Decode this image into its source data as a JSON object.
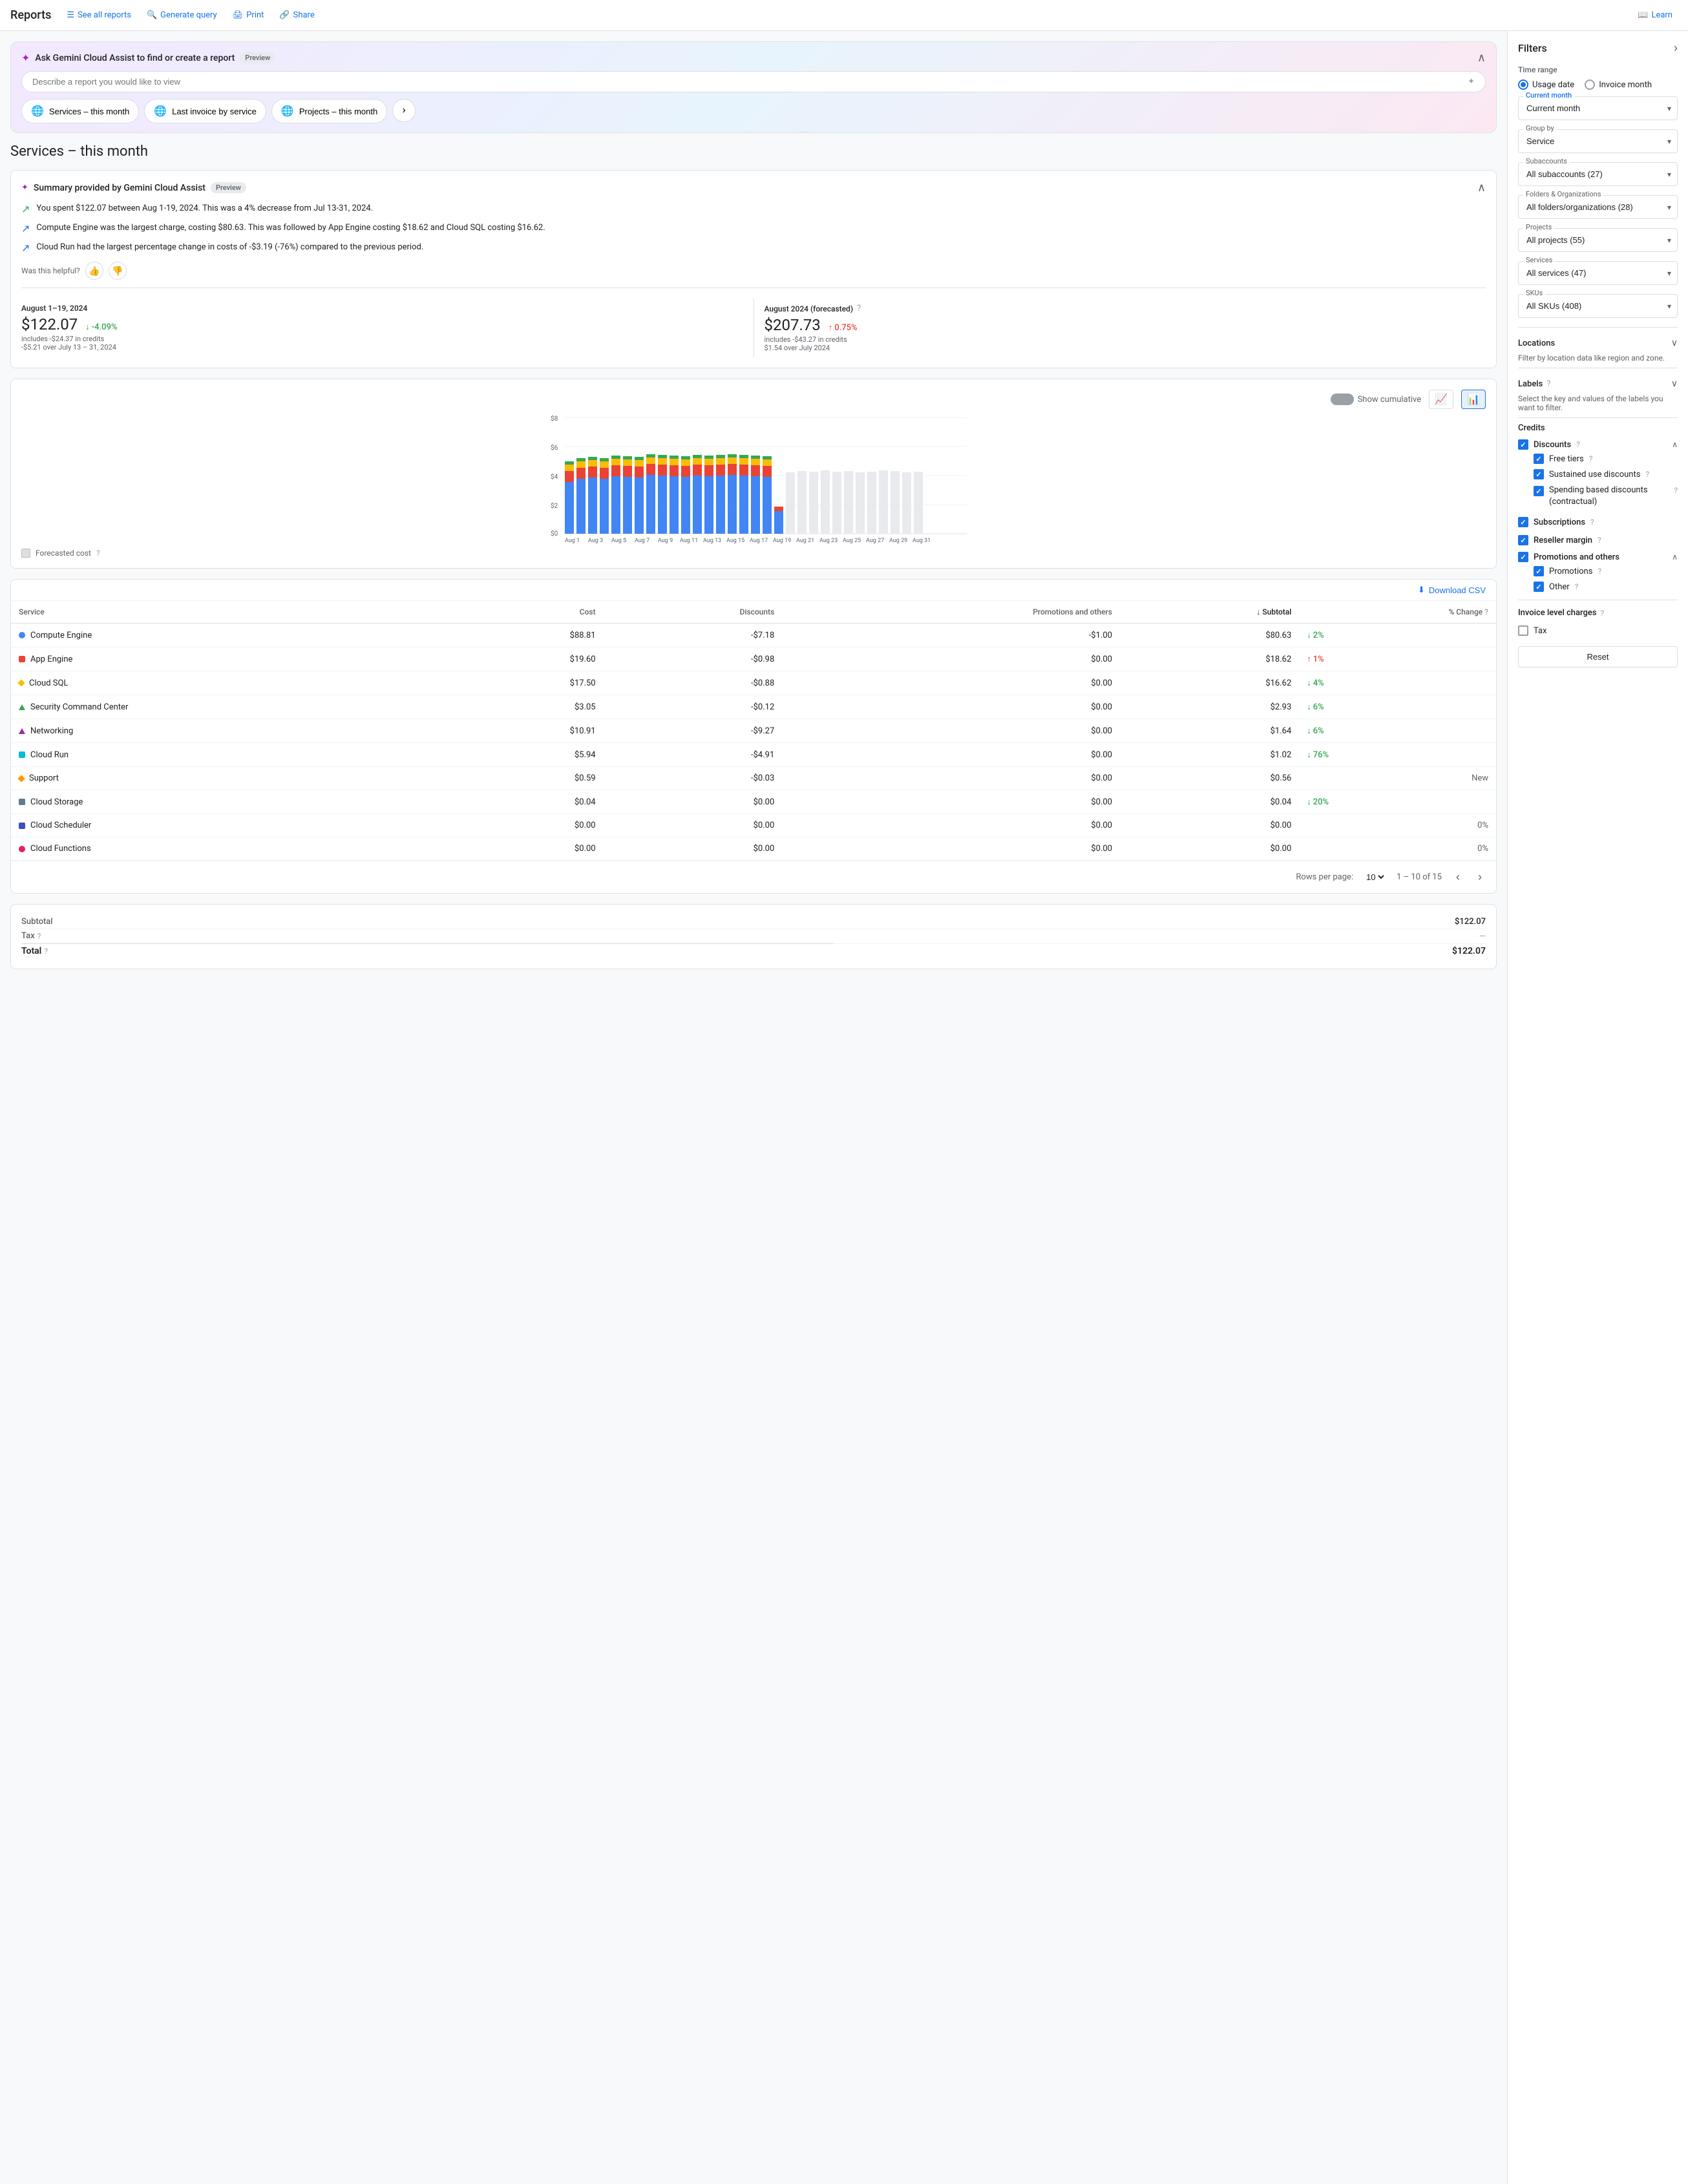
{
  "nav": {
    "brand": "Reports",
    "links": [
      {
        "id": "see-all-reports",
        "label": "See all reports",
        "icon": "☰"
      },
      {
        "id": "generate-query",
        "label": "Generate query",
        "icon": "🔍"
      },
      {
        "id": "print",
        "label": "Print",
        "icon": "🖨"
      },
      {
        "id": "share",
        "label": "Share",
        "icon": "🔗"
      },
      {
        "id": "learn",
        "label": "Learn",
        "icon": "📖"
      }
    ]
  },
  "gemini": {
    "title": "Ask Gemini Cloud Assist to find or create a report",
    "badge": "Preview",
    "placeholder": "Describe a report you would like to view",
    "quick_reports": [
      {
        "label": "Services – this month"
      },
      {
        "label": "Last invoice by service"
      },
      {
        "label": "Projects – this month"
      }
    ]
  },
  "page_title": "Services – this month",
  "summary": {
    "title": "Summary provided by Gemini Cloud Assist",
    "badge": "Preview",
    "bullets": [
      "You spent $122.07 between Aug 1-19, 2024. This was a 4% decrease from Jul 13-31, 2024.",
      "Compute Engine was the largest charge, costing $80.63. This was followed by App Engine costing $18.62 and Cloud SQL costing $16.62.",
      "Cloud Run had the largest percentage change in costs of -$3.19 (-76%) compared to the previous period."
    ],
    "helpful_label": "Was this helpful?"
  },
  "stats": {
    "current": {
      "period": "August 1–19, 2024",
      "amount": "$122.07",
      "sub": "includes -$24.37 in credits",
      "change_pct": "-4.09%",
      "change_direction": "down",
      "change_sub": "-$5.21 over July 13 – 31, 2024"
    },
    "forecasted": {
      "period": "August 2024 (forecasted)",
      "amount": "$207.73",
      "sub": "includes -$43.27 in credits",
      "change_pct": "0.75%",
      "change_direction": "up",
      "change_sub": "$1.54 over July 2024"
    }
  },
  "chart": {
    "y_labels": [
      "$8",
      "$6",
      "$4",
      "$2",
      "$0"
    ],
    "x_labels": [
      "Aug 1",
      "Aug 3",
      "Aug 5",
      "Aug 7",
      "Aug 9",
      "Aug 11",
      "Aug 13",
      "Aug 15",
      "Aug 17",
      "Aug 19",
      "Aug 21",
      "Aug 23",
      "Aug 25",
      "Aug 27",
      "Aug 29",
      "Aug 31"
    ],
    "show_cumulative": "Show cumulative",
    "forecasted_label": "Forecasted cost"
  },
  "table": {
    "download_label": "Download CSV",
    "columns": [
      "Service",
      "Cost",
      "Discounts",
      "Promotions and others",
      "Subtotal",
      "% Change"
    ],
    "rows": [
      {
        "name": "Compute Engine",
        "color": "#4285f4",
        "shape": "circle",
        "cost": "$88.81",
        "discounts": "-$7.18",
        "promotions": "-$1.00",
        "subtotal": "$80.63",
        "change": "2%",
        "change_dir": "down"
      },
      {
        "name": "App Engine",
        "color": "#ea4335",
        "shape": "square",
        "cost": "$19.60",
        "discounts": "-$0.98",
        "promotions": "$0.00",
        "subtotal": "$18.62",
        "change": "1%",
        "change_dir": "up"
      },
      {
        "name": "Cloud SQL",
        "color": "#fbbc04",
        "shape": "diamond",
        "cost": "$17.50",
        "discounts": "-$0.88",
        "promotions": "$0.00",
        "subtotal": "$16.62",
        "change": "4%",
        "change_dir": "down"
      },
      {
        "name": "Security Command Center",
        "color": "#34a853",
        "shape": "triangle",
        "cost": "$3.05",
        "discounts": "-$0.12",
        "promotions": "$0.00",
        "subtotal": "$2.93",
        "change": "6%",
        "change_dir": "down"
      },
      {
        "name": "Networking",
        "color": "#9c27b0",
        "shape": "triangle",
        "cost": "$10.91",
        "discounts": "-$9.27",
        "promotions": "$0.00",
        "subtotal": "$1.64",
        "change": "6%",
        "change_dir": "down"
      },
      {
        "name": "Cloud Run",
        "color": "#00bcd4",
        "shape": "square",
        "cost": "$5.94",
        "discounts": "-$4.91",
        "promotions": "$0.00",
        "subtotal": "$1.02",
        "change": "76%",
        "change_dir": "down"
      },
      {
        "name": "Support",
        "color": "#ff9800",
        "shape": "diamond",
        "cost": "$0.59",
        "discounts": "-$0.03",
        "promotions": "$0.00",
        "subtotal": "$0.56",
        "change": "New",
        "change_dir": "gray"
      },
      {
        "name": "Cloud Storage",
        "color": "#607d8b",
        "shape": "square",
        "cost": "$0.04",
        "discounts": "$0.00",
        "promotions": "$0.00",
        "subtotal": "$0.04",
        "change": "20%",
        "change_dir": "down"
      },
      {
        "name": "Cloud Scheduler",
        "color": "#3f51b5",
        "shape": "square",
        "cost": "$0.00",
        "discounts": "$0.00",
        "promotions": "$0.00",
        "subtotal": "$0.00",
        "change": "0%",
        "change_dir": "gray"
      },
      {
        "name": "Cloud Functions",
        "color": "#e91e63",
        "shape": "circle",
        "cost": "$0.00",
        "discounts": "$0.00",
        "promotions": "$0.00",
        "subtotal": "$0.00",
        "change": "0%",
        "change_dir": "gray"
      }
    ],
    "pagination": {
      "rows_label": "Rows per page:",
      "rows_value": "10",
      "range": "1 – 10 of 15"
    }
  },
  "totals": {
    "subtotal_label": "Subtotal",
    "subtotal_value": "$122.07",
    "tax_label": "Tax",
    "tax_value": "—",
    "total_label": "Total",
    "total_value": "$122.07"
  },
  "filters": {
    "title": "Filters",
    "time_range_label": "Time range",
    "usage_date_label": "Usage date",
    "invoice_month_label": "Invoice month",
    "current_month_label": "Current month",
    "group_by_label": "Group by",
    "group_by_value": "Service",
    "subaccounts_label": "Subaccounts",
    "subaccounts_value": "All subaccounts (27)",
    "folders_label": "Folders & Organizations",
    "folders_value": "All folders/organizations (28)",
    "projects_label": "Projects",
    "projects_value": "All projects (55)",
    "services_label": "Services",
    "services_value": "All services (47)",
    "skus_label": "SKUs",
    "skus_value": "All SKUs (408)",
    "locations_label": "Locations",
    "locations_sub": "Filter by location data like region and zone.",
    "labels_label": "Labels",
    "labels_sub": "Select the key and values of the labels you want to filter.",
    "credits": {
      "label": "Credits",
      "discounts": {
        "label": "Discounts",
        "items": [
          "Free tiers",
          "Sustained use discounts",
          "Spending based discounts (contractual)"
        ]
      },
      "subscriptions": "Subscriptions",
      "reseller_margin": "Reseller margin",
      "promotions_others": {
        "label": "Promotions and others",
        "items": [
          "Promotions",
          "Other"
        ]
      }
    },
    "invoice_charges_label": "Invoice level charges",
    "tax_label": "Tax",
    "reset_label": "Reset"
  }
}
